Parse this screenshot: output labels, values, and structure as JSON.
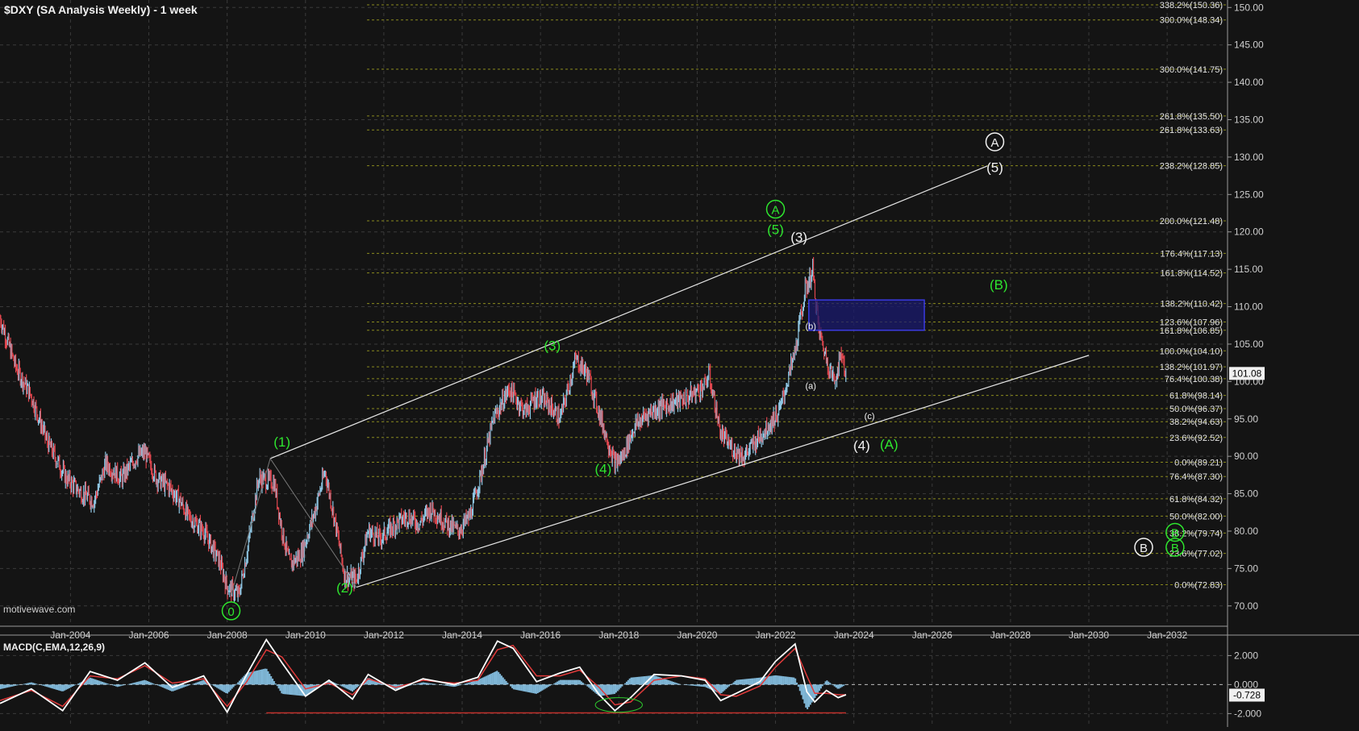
{
  "title": "$DXY (SA Analysis Weekly) - 1 week",
  "watermark": "motivewave.com",
  "colors": {
    "background": "#141414",
    "grid": "#3a3a3a",
    "fib_line": "#8a8a1e",
    "up_bar": "#8fc6e3",
    "down_bar": "#e0464e",
    "green_label": "#2ee62e",
    "white_label": "#f2f2f2",
    "channel": "#e8e8e8",
    "target_box": "#1a1a6e",
    "target_box_border": "#3a3ae0",
    "macd_line": "#ffffff",
    "signal_line": "#e03a3a",
    "histogram": "#7fb6d6",
    "macd_ref_line": "#c0302a"
  },
  "chart_data": [
    {
      "type": "line",
      "title": "$DXY (SA Analysis Weekly) - 1 week",
      "x_ticks": [
        "Jan-2004",
        "Jan-2006",
        "Jan-2008",
        "Jan-2010",
        "Jan-2012",
        "Jan-2014",
        "Jan-2016",
        "Jan-2018",
        "Jan-2020",
        "Jan-2022",
        "Jan-2024",
        "Jan-2026",
        "Jan-2028",
        "Jan-2030",
        "Jan-2032"
      ],
      "y_ticks": [
        "70.00",
        "75.00",
        "80.00",
        "85.00",
        "90.00",
        "95.00",
        "100.00",
        "105.00",
        "110.00",
        "115.00",
        "120.00",
        "125.00",
        "130.00",
        "135.00",
        "140.00",
        "145.00",
        "150.00"
      ],
      "xlim": [
        2002.2,
        2033.5
      ],
      "ylim": [
        67.5,
        151.0
      ],
      "grid": true,
      "price_label": "101.08",
      "series": [
        {
          "x": [
            2002.2,
            2002.6,
            2003.0,
            2003.4,
            2003.9,
            2004.3,
            2004.6,
            2004.9,
            2005.3,
            2005.7,
            2005.9,
            2006.2,
            2006.5,
            2006.8,
            2007.0,
            2007.4,
            2007.8,
            2008.0,
            2008.3,
            2008.5,
            2008.8,
            2009.2,
            2009.4,
            2009.6,
            2009.9,
            2010.2,
            2010.5,
            2010.8,
            2011.0,
            2011.3,
            2011.6,
            2011.9,
            2012.3,
            2012.6,
            2012.9,
            2013.2,
            2013.6,
            2013.9,
            2014.2,
            2014.5,
            2014.8,
            2015.2,
            2015.6,
            2015.9,
            2016.2,
            2016.5,
            2016.9,
            2017.2,
            2017.6,
            2017.9,
            2018.1,
            2018.4,
            2018.8,
            2019.3,
            2019.8,
            2020.2,
            2020.3,
            2020.6,
            2020.9,
            2021.2,
            2021.5,
            2021.8,
            2022.1,
            2022.5,
            2022.75,
            2022.95,
            2023.1,
            2023.3,
            2023.5,
            2023.7,
            2023.8
          ],
          "y": [
            108.5,
            102,
            98,
            92,
            87,
            85,
            84,
            89,
            87,
            90,
            90.5,
            87,
            86,
            84,
            82,
            80,
            76,
            72.5,
            71.5,
            77,
            87,
            86.5,
            80,
            75.5,
            77,
            82,
            88,
            80,
            74,
            73.5,
            80,
            79,
            81,
            82,
            81,
            83,
            81,
            80,
            82,
            88,
            95,
            99,
            96,
            98,
            97,
            95,
            103,
            101,
            94,
            89,
            90,
            94,
            96,
            97,
            98,
            99.5,
            101,
            93,
            91,
            90,
            92,
            94,
            96,
            104,
            112,
            114.8,
            107,
            103,
            100,
            104,
            100.3
          ]
        }
      ],
      "fib_levels": [
        {
          "label": "338.2%(150.36)",
          "value": 150.36
        },
        {
          "label": "300.0%(148.34)",
          "value": 148.34
        },
        {
          "label": "300.0%(141.75)",
          "value": 141.75
        },
        {
          "label": "261.8%(135.50)",
          "value": 135.5
        },
        {
          "label": "261.8%(133.63)",
          "value": 133.63
        },
        {
          "label": "238.2%(128.85)",
          "value": 128.85
        },
        {
          "label": "200.0%(121.48)",
          "value": 121.48
        },
        {
          "label": "176.4%(117.13)",
          "value": 117.13
        },
        {
          "label": "161.8%(114.52)",
          "value": 114.52
        },
        {
          "label": "138.2%(110.42)",
          "value": 110.42
        },
        {
          "label": "123.6%(107.96)",
          "value": 107.96
        },
        {
          "label": "161.8%(106.85)",
          "value": 106.85
        },
        {
          "label": "100.0%(104.10)",
          "value": 104.1
        },
        {
          "label": "138.2%(101.97)",
          "value": 101.97
        },
        {
          "label": "76.4%(100.38)",
          "value": 100.38
        },
        {
          "label": "61.8%(98.14)",
          "value": 98.14
        },
        {
          "label": "50.0%(96.37)",
          "value": 96.37
        },
        {
          "label": "38.2%(94.63)",
          "value": 94.63
        },
        {
          "label": "23.6%(92.52)",
          "value": 92.52
        },
        {
          "label": "0.0%(89.21)",
          "value": 89.21
        },
        {
          "label": "76.4%(87.30)",
          "value": 87.3
        },
        {
          "label": "61.8%(84.32)",
          "value": 84.32
        },
        {
          "label": "50.0%(82.00)",
          "value": 82.0
        },
        {
          "label": "38.2%(79.74)",
          "value": 79.74
        },
        {
          "label": "23.6%(77.02)",
          "value": 77.02
        },
        {
          "label": "0.0%(72.83)",
          "value": 72.83
        }
      ],
      "wave_labels": [
        {
          "text": "0",
          "color": "green",
          "circled": true,
          "x": 2008.1,
          "y": 68.8
        },
        {
          "text": "(1)",
          "color": "green",
          "x": 2009.4,
          "y": 91.3
        },
        {
          "text": "(2)",
          "color": "green",
          "x": 2011.0,
          "y": 71.8
        },
        {
          "text": "(3)",
          "color": "green",
          "x": 2016.3,
          "y": 104.2
        },
        {
          "text": "(4)",
          "color": "green",
          "x": 2017.6,
          "y": 87.7
        },
        {
          "text": "(5)",
          "color": "green",
          "x": 2022.0,
          "y": 119.7
        },
        {
          "text": "A",
          "color": "green",
          "circled": true,
          "x": 2022.0,
          "y": 122.5
        },
        {
          "text": "(3)",
          "color": "white",
          "x": 2022.6,
          "y": 118.7
        },
        {
          "text": "(b)",
          "color": "white",
          "x": 2022.9,
          "y": 107.0
        },
        {
          "text": "(a)",
          "color": "white",
          "x": 2022.9,
          "y": 99.0
        },
        {
          "text": "(c)",
          "color": "white",
          "x": 2024.4,
          "y": 95.0
        },
        {
          "text": "(4)",
          "color": "white",
          "x": 2024.2,
          "y": 90.8
        },
        {
          "text": "(A)",
          "color": "green",
          "x": 2024.9,
          "y": 91.0
        },
        {
          "text": "(B)",
          "color": "green",
          "x": 2027.7,
          "y": 112.3
        },
        {
          "text": "A",
          "color": "white",
          "circled": true,
          "x": 2027.6,
          "y": 131.5
        },
        {
          "text": "(5)",
          "color": "white",
          "x": 2027.6,
          "y": 128.0
        },
        {
          "text": "B",
          "color": "white",
          "circled": true,
          "x": 2031.4,
          "y": 77.3
        },
        {
          "text": "B",
          "color": "green",
          "circled": true,
          "x": 2032.2,
          "y": 77.3
        },
        {
          "text": "B",
          "color": "green",
          "circled": true,
          "x": 2032.2,
          "y": 79.3
        }
      ],
      "channel_lines": [
        {
          "x1": 2009.1,
          "y1": 89.7,
          "x2": 2027.4,
          "y2": 128.8
        },
        {
          "x1": 2011.3,
          "y1": 72.5,
          "x2": 2030.0,
          "y2": 103.5
        }
      ],
      "target_box": {
        "x1": 2022.85,
        "x2": 2025.8,
        "y1": 106.85,
        "y2": 110.9
      }
    },
    {
      "type": "line",
      "title": "MACD(C,EMA,12,26,9)",
      "y_ticks": [
        "2.000",
        "0.000",
        "-2.000"
      ],
      "ylim": [
        -2.7,
        3.3
      ],
      "value_label": "-0.728",
      "series": [
        {
          "name": "MACD",
          "x": [
            2002.2,
            2003.0,
            2003.8,
            2004.5,
            2005.2,
            2005.9,
            2006.6,
            2007.4,
            2008.0,
            2008.5,
            2009.0,
            2009.4,
            2010.0,
            2010.6,
            2011.2,
            2011.6,
            2012.3,
            2013.0,
            2013.8,
            2014.4,
            2014.9,
            2015.3,
            2015.9,
            2016.5,
            2017.0,
            2017.5,
            2017.9,
            2018.3,
            2018.9,
            2019.6,
            2020.2,
            2020.6,
            2021.0,
            2021.6,
            2022.0,
            2022.5,
            2022.8,
            2023.0,
            2023.3,
            2023.6,
            2023.8
          ],
          "y": [
            -1.3,
            -0.3,
            -1.8,
            0.9,
            0.3,
            1.5,
            -0.2,
            0.6,
            -1.9,
            0.7,
            3.1,
            1.5,
            -0.8,
            0.3,
            -1.0,
            0.7,
            -0.4,
            0.4,
            0.0,
            0.5,
            3.0,
            2.5,
            0.2,
            0.8,
            1.2,
            -0.7,
            -1.8,
            -0.9,
            0.7,
            0.6,
            0.3,
            -1.1,
            -0.6,
            0.2,
            1.6,
            2.8,
            -0.5,
            -1.2,
            -0.4,
            -0.9,
            -0.7
          ]
        },
        {
          "name": "Signal",
          "x": [
            2002.2,
            2003.0,
            2003.8,
            2004.5,
            2005.2,
            2005.9,
            2006.6,
            2007.4,
            2008.0,
            2008.5,
            2009.0,
            2009.4,
            2010.0,
            2010.6,
            2011.2,
            2011.6,
            2012.3,
            2013.0,
            2013.8,
            2014.4,
            2014.9,
            2015.3,
            2015.9,
            2016.5,
            2017.0,
            2017.5,
            2017.9,
            2018.3,
            2018.9,
            2019.6,
            2020.2,
            2020.6,
            2021.0,
            2021.6,
            2022.0,
            2022.5,
            2022.8,
            2023.0,
            2023.3,
            2023.6,
            2023.8
          ],
          "y": [
            -1.1,
            -0.4,
            -1.5,
            0.6,
            0.4,
            1.3,
            0.1,
            0.4,
            -1.5,
            0.2,
            2.4,
            1.9,
            -0.3,
            0.1,
            -0.7,
            0.4,
            -0.2,
            0.3,
            0.1,
            0.3,
            2.4,
            2.7,
            0.6,
            0.6,
            1.0,
            -0.2,
            -1.4,
            -1.2,
            0.3,
            0.6,
            0.4,
            -0.7,
            -0.8,
            -0.1,
            1.2,
            2.5,
            0.6,
            -0.6,
            -0.6,
            -0.7,
            -0.7
          ]
        }
      ],
      "ref_line": {
        "x1": 2009.0,
        "x2": 2023.8,
        "y": -1.95
      },
      "ellipse": {
        "x": 2018.0,
        "y": -1.4,
        "rx": 0.6,
        "ry": 0.5
      }
    }
  ]
}
